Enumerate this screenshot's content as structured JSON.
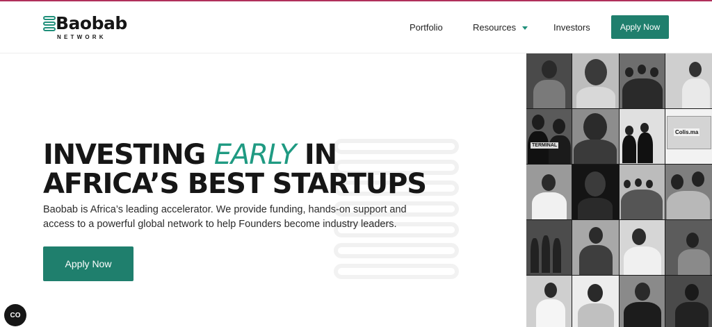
{
  "brand": {
    "name": "Baobab",
    "subtitle": "NETWORK"
  },
  "nav": {
    "items": [
      "Portfolio",
      "Resources",
      "Investors"
    ],
    "cta": "Apply Now"
  },
  "hero": {
    "headline_part1": "INVESTING ",
    "headline_emphasis": "EARLY",
    "headline_part2": " IN",
    "headline_line2": "AFRICA’S BEST STARTUPS",
    "description": "Baobab is Africa’s leading accelerator. We provide funding, hands-on support and access to a powerful global network to help Founders become industry leaders.",
    "cta": "Apply Now"
  },
  "collage": {
    "signage": [
      "Colis.ma",
      "TERMINAL"
    ]
  },
  "widget": {
    "label": "CO"
  },
  "colors": {
    "accent": "#1f7f6d",
    "accent_text": "#1f9a82",
    "top_border": "#b0305a"
  }
}
